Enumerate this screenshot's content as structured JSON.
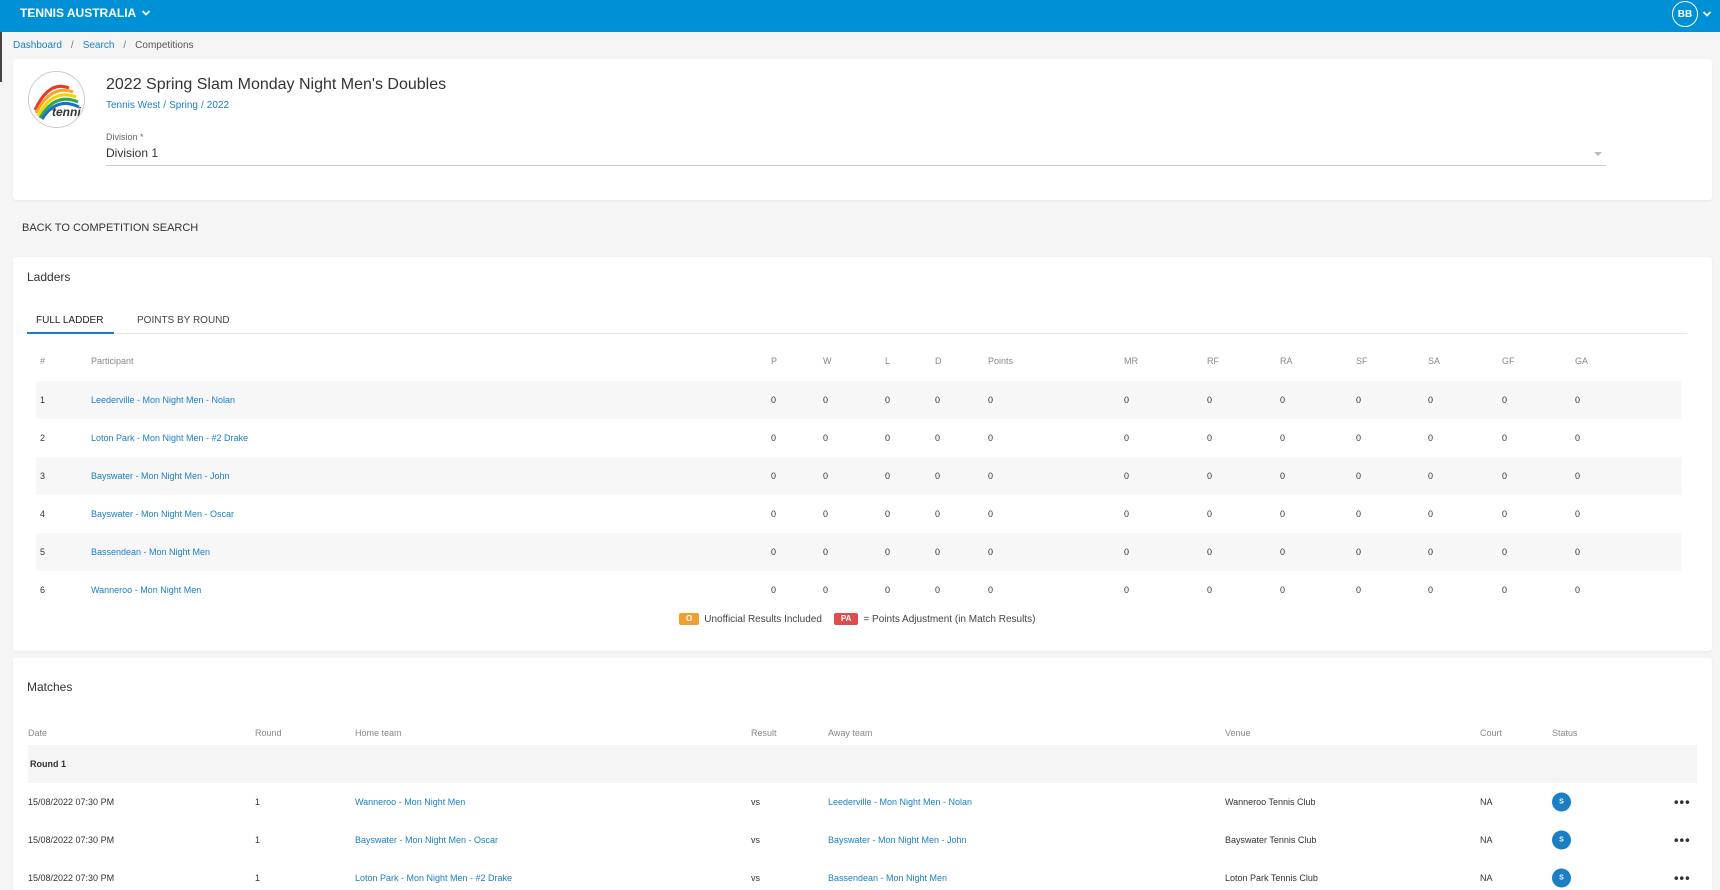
{
  "topbar": {
    "org_label": "TENNIS AUSTRALIA",
    "user_initials": "BB"
  },
  "breadcrumb": [
    "Dashboard",
    "Search",
    "Competitions"
  ],
  "competition": {
    "title": "2022 Spring Slam Monday Night Men's Doubles",
    "path": [
      "Tennis West",
      "Spring",
      "2022"
    ],
    "logo_text": "tennis",
    "division_label": "Division *",
    "division_value": "Division 1"
  },
  "back_link": "BACK TO COMPETITION SEARCH",
  "ladders": {
    "title": "Ladders",
    "tabs": [
      "FULL LADDER",
      "POINTS BY ROUND"
    ],
    "columns": [
      "#",
      "Participant",
      "P",
      "W",
      "L",
      "D",
      "Points",
      "MR",
      "RF",
      "RA",
      "SF",
      "SA",
      "GF",
      "GA"
    ],
    "rows": [
      [
        "1",
        "Leederville - Mon Night Men - Nolan",
        "0",
        "0",
        "0",
        "0",
        "0",
        "0",
        "0",
        "0",
        "0",
        "0",
        "0",
        "0"
      ],
      [
        "2",
        "Loton Park - Mon Night Men - #2 Drake",
        "0",
        "0",
        "0",
        "0",
        "0",
        "0",
        "0",
        "0",
        "0",
        "0",
        "0",
        "0"
      ],
      [
        "3",
        "Bayswater - Mon Night Men - John",
        "0",
        "0",
        "0",
        "0",
        "0",
        "0",
        "0",
        "0",
        "0",
        "0",
        "0",
        "0"
      ],
      [
        "4",
        "Bayswater - Mon Night Men - Oscar",
        "0",
        "0",
        "0",
        "0",
        "0",
        "0",
        "0",
        "0",
        "0",
        "0",
        "0",
        "0"
      ],
      [
        "5",
        "Bassendean - Mon Night Men",
        "0",
        "0",
        "0",
        "0",
        "0",
        "0",
        "0",
        "0",
        "0",
        "0",
        "0",
        "0"
      ],
      [
        "6",
        "Wanneroo - Mon Night Men",
        "0",
        "0",
        "0",
        "0",
        "0",
        "0",
        "0",
        "0",
        "0",
        "0",
        "0",
        "0"
      ]
    ],
    "legend": {
      "unofficial_badge": "O",
      "unofficial_text": "Unofficial Results Included",
      "pa_badge": "PA",
      "pa_text": "= Points Adjustment (in Match Results)"
    }
  },
  "matches": {
    "title": "Matches",
    "columns": [
      "Date",
      "Round",
      "Home team",
      "Result",
      "Away team",
      "Venue",
      "Court",
      "Status"
    ],
    "round_label": "Round 1",
    "rows": [
      [
        "15/08/2022 07:30 PM",
        "1",
        "Wanneroo - Mon Night Men",
        "vs",
        "Leederville - Mon Night Men - Nolan",
        "Wanneroo Tennis Club",
        "NA",
        "S"
      ],
      [
        "15/08/2022 07:30 PM",
        "1",
        "Bayswater - Mon Night Men - Oscar",
        "vs",
        "Bayswater - Mon Night Men - John",
        "Bayswater Tennis Club",
        "NA",
        "S"
      ],
      [
        "15/08/2022 07:30 PM",
        "1",
        "Loton Park - Mon Night Men - #2 Drake",
        "vs",
        "Bassendean - Mon Night Men",
        "Loton Park Tennis Club",
        "NA",
        "S"
      ]
    ],
    "more_label": "•••"
  },
  "colors": {
    "topbar": "#0090d6",
    "link": "#1a7fc4",
    "unofficial_badge": "#f0a030",
    "pa_badge": "#e04b4b"
  }
}
